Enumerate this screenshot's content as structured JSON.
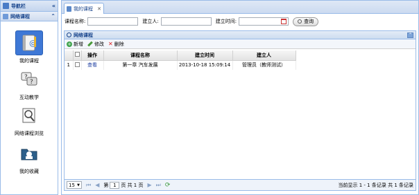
{
  "sidebar": {
    "title": "导航栏",
    "section": "网络课程",
    "items": [
      {
        "label": "我的课程",
        "icon": "notebook-icon"
      },
      {
        "label": "互动教学",
        "icon": "chat-bubbles-icon"
      },
      {
        "label": "网络课程浏览",
        "icon": "magnifier-book-icon"
      },
      {
        "label": "我的收藏",
        "icon": "folder-icon"
      }
    ]
  },
  "tab": {
    "label": "我的课程"
  },
  "search": {
    "course_label": "课程名称:",
    "creator_label": "建立人:",
    "time_label": "建立时间:",
    "query_label": "查询"
  },
  "panel": {
    "title": "网络课程",
    "toolbar": {
      "add": "新增",
      "edit": "修改",
      "delete": "删除"
    },
    "columns": [
      "操作",
      "课程名称",
      "建立时间",
      "建立人"
    ],
    "rows": [
      {
        "num": "1",
        "action": "查看",
        "name": "第一章 汽车发展",
        "time": "2013-10-18 15:09:14",
        "creator": "管理员（教师测试）"
      }
    ]
  },
  "pager": {
    "page_size": "15",
    "page_prefix": "第",
    "page_num": "1",
    "page_suffix": "页 共 1 页",
    "info": "当前显示 1 - 1 条记录 共 1 条记录"
  },
  "colors": {
    "border": "#99bbe8",
    "header_text": "#15428b",
    "selected": "#3e78d6"
  }
}
